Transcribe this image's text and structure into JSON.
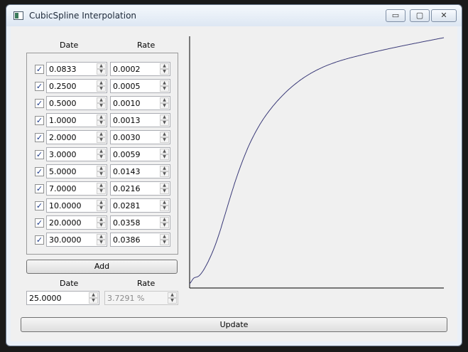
{
  "window": {
    "title": "CubicSpline Interpolation"
  },
  "controls": {
    "minimize": "▭",
    "maximize": "▢",
    "close": "✕"
  },
  "table": {
    "headers": {
      "date": "Date",
      "rate": "Rate"
    },
    "rows": [
      {
        "checked": true,
        "date": "0.0833",
        "rate": "0.0002"
      },
      {
        "checked": true,
        "date": "0.2500",
        "rate": "0.0005"
      },
      {
        "checked": true,
        "date": "0.5000",
        "rate": "0.0010"
      },
      {
        "checked": true,
        "date": "1.0000",
        "rate": "0.0013"
      },
      {
        "checked": true,
        "date": "2.0000",
        "rate": "0.0030"
      },
      {
        "checked": true,
        "date": "3.0000",
        "rate": "0.0059"
      },
      {
        "checked": true,
        "date": "5.0000",
        "rate": "0.0143"
      },
      {
        "checked": true,
        "date": "7.0000",
        "rate": "0.0216"
      },
      {
        "checked": true,
        "date": "10.0000",
        "rate": "0.0281"
      },
      {
        "checked": true,
        "date": "20.0000",
        "rate": "0.0358"
      },
      {
        "checked": true,
        "date": "30.0000",
        "rate": "0.0386"
      }
    ]
  },
  "add_button": "Add",
  "query": {
    "date_label": "Date",
    "rate_label": "Rate",
    "date_value": "25.0000",
    "rate_value": "3.7291 %"
  },
  "update_button": "Update",
  "chart_data": {
    "type": "line",
    "title": "",
    "xlabel": "",
    "ylabel": "",
    "series": [
      {
        "x": [
          0.0833,
          0.25,
          0.5,
          1,
          2,
          3,
          5,
          7,
          10,
          20,
          30
        ],
        "y": [
          0.0002,
          0.0005,
          0.001,
          0.0013,
          0.003,
          0.0059,
          0.0143,
          0.0216,
          0.0281,
          0.0358,
          0.0386
        ],
        "color": "#3a3a78"
      }
    ]
  }
}
